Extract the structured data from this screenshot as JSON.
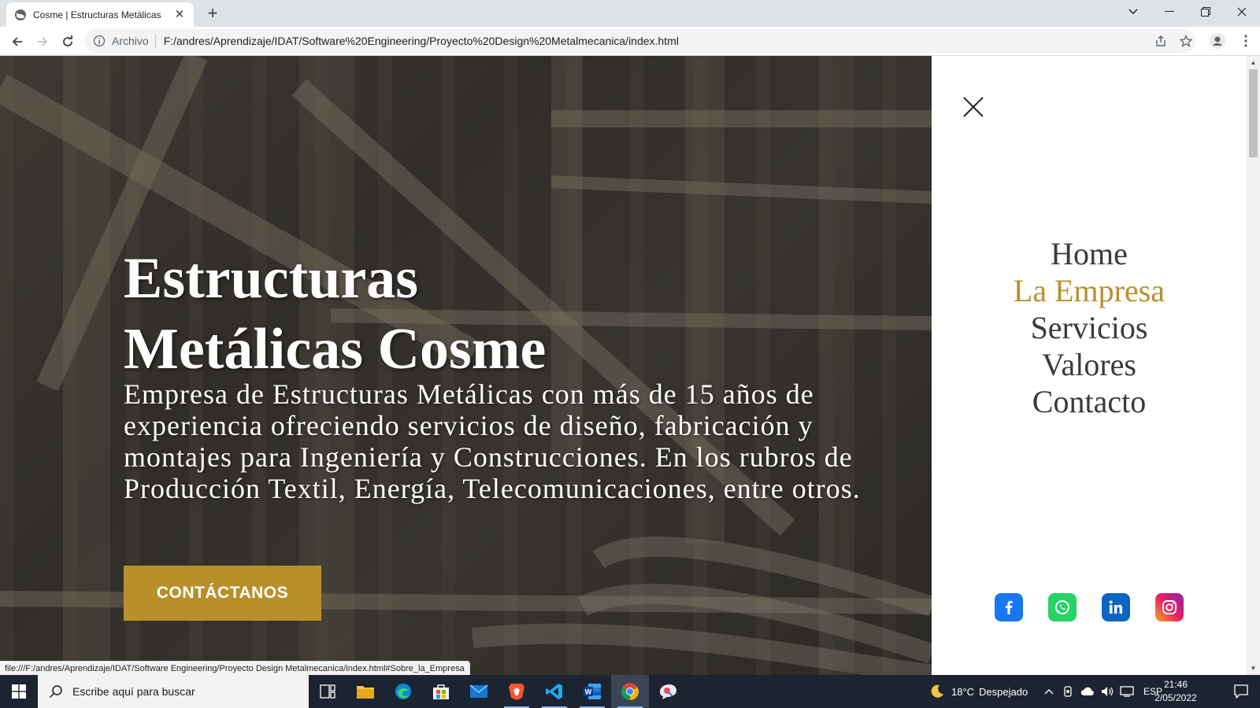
{
  "browser": {
    "tab_title": "Cosme | Estructuras Metálicas",
    "security_chip": "Archivo",
    "url": "F:/andres/Aprendizaje/IDAT/Software%20Engineering/Proyecto%20Design%20Metalmecanica/index.html",
    "status_url": "file:///F:/andres/Aprendizaje/IDAT/Software Engineering/Proyecto Design Metalmecanica/index.html#Sobre_la_Empresa"
  },
  "hero": {
    "title_line1": "Estructuras",
    "title_line2": "Metálicas Cosme",
    "description": "Empresa de Estructuras Metálicas con más de 15 años de experiencia ofreciendo servicios de diseño, fabricación y montajes para Ingeniería y Construcciones. En los rubros de Producción Textil, Energía, Telecomunicaciones, entre otros.",
    "cta_label": "CONTÁCTANOS"
  },
  "menu": {
    "items": [
      {
        "label": "Home"
      },
      {
        "label": "La Empresa"
      },
      {
        "label": "Servicios"
      },
      {
        "label": "Valores"
      },
      {
        "label": "Contacto"
      }
    ],
    "active_item": "La Empresa",
    "accent_color": "#b8902a",
    "socials": [
      "facebook-icon",
      "whatsapp-icon",
      "linkedin-icon",
      "instagram-icon"
    ]
  },
  "taskbar": {
    "search_placeholder": "Escribe aquí para buscar",
    "weather_temp": "18°C",
    "weather_desc": "Despejado",
    "language": "ESP",
    "time": "21:46",
    "date": "2/05/2022"
  }
}
